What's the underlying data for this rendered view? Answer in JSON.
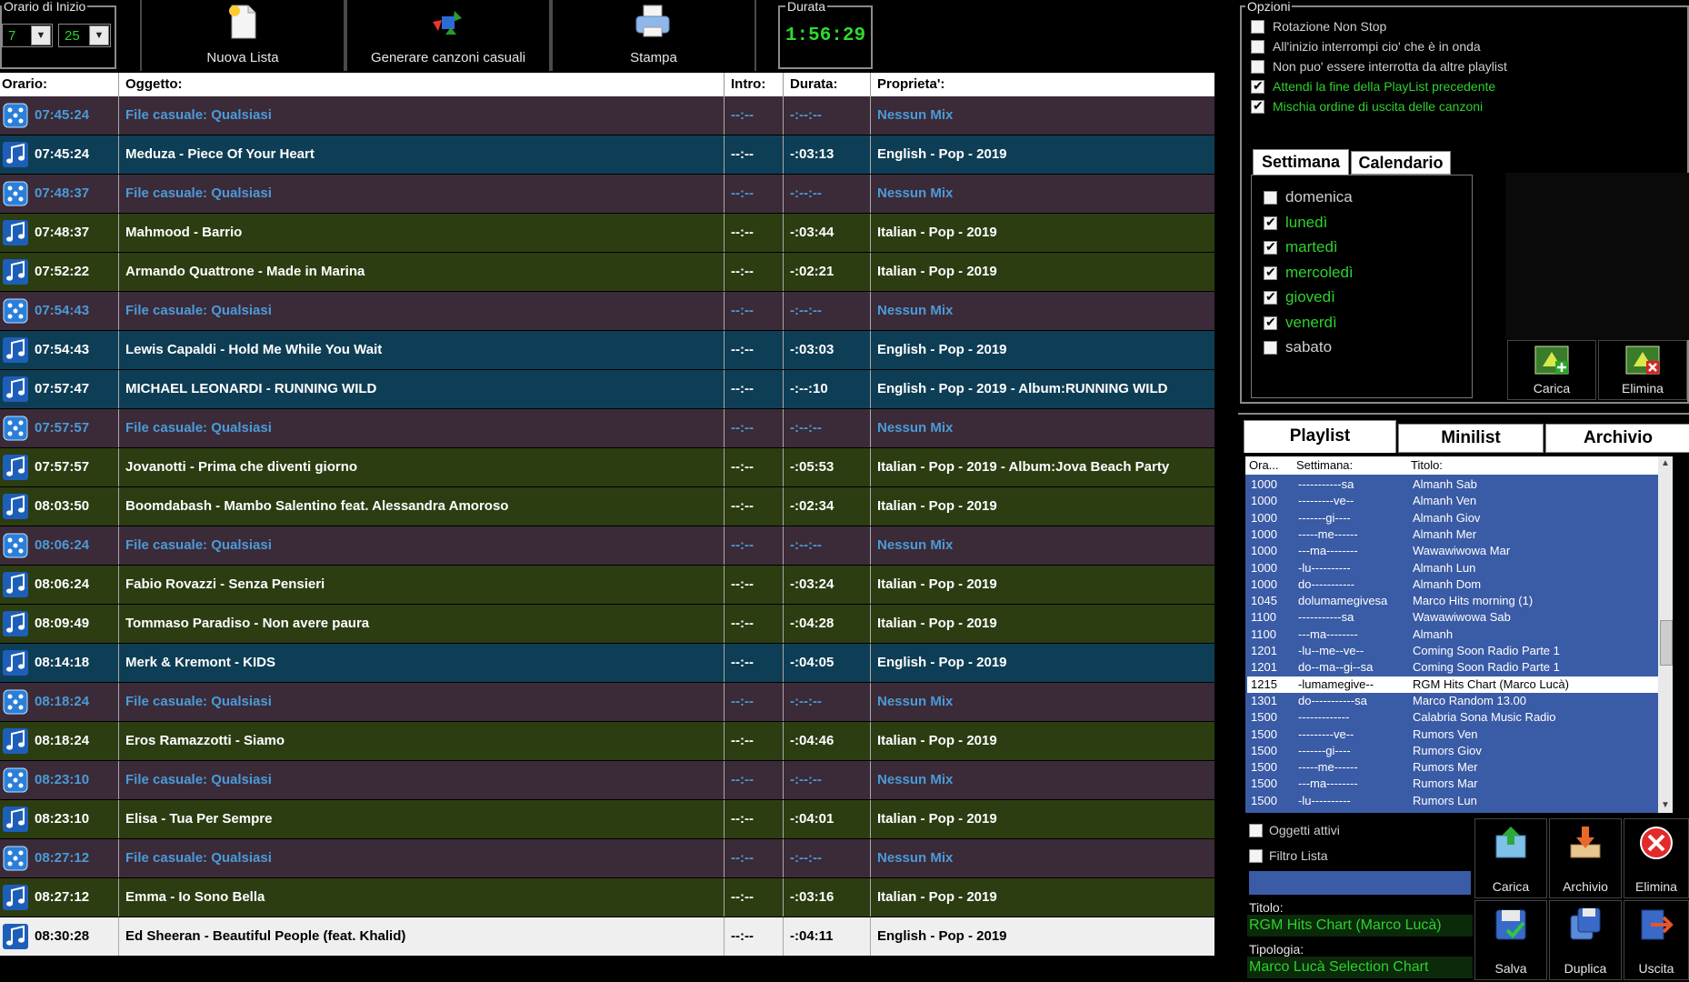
{
  "toolbar": {
    "start_time_legend": "Orario di Inizio",
    "start_hour": "7",
    "start_minute": "25",
    "new_list": "Nuova Lista",
    "random_songs": "Generare canzoni casuali",
    "print": "Stampa",
    "duration_legend": "Durata",
    "duration": "1:56:29"
  },
  "table": {
    "headers": {
      "time": "Orario:",
      "object": "Oggetto:",
      "intro": "Intro:",
      "duration": "Durata:",
      "property": "Proprieta':"
    },
    "rows": [
      {
        "type": "random",
        "time": "07:45:24",
        "object": "File casuale: Qualsiasi",
        "intro": "--:--",
        "duration": "-:--:--",
        "property": "Nessun Mix"
      },
      {
        "type": "en",
        "time": "07:45:24",
        "object": "Meduza - Piece Of Your Heart",
        "intro": "--:--",
        "duration": "-:03:13",
        "property": "English - Pop - 2019"
      },
      {
        "type": "random",
        "time": "07:48:37",
        "object": "File casuale: Qualsiasi",
        "intro": "--:--",
        "duration": "-:--:--",
        "property": "Nessun Mix"
      },
      {
        "type": "it",
        "time": "07:48:37",
        "object": "Mahmood - Barrio",
        "intro": "--:--",
        "duration": "-:03:44",
        "property": "Italian - Pop - 2019"
      },
      {
        "type": "it",
        "time": "07:52:22",
        "object": "Armando Quattrone - Made in Marina",
        "intro": "--:--",
        "duration": "-:02:21",
        "property": "Italian - Pop - 2019"
      },
      {
        "type": "random",
        "time": "07:54:43",
        "object": "File casuale: Qualsiasi",
        "intro": "--:--",
        "duration": "-:--:--",
        "property": "Nessun Mix"
      },
      {
        "type": "en",
        "time": "07:54:43",
        "object": "Lewis Capaldi - Hold Me While You Wait",
        "intro": "--:--",
        "duration": "-:03:03",
        "property": "English - Pop - 2019"
      },
      {
        "type": "en",
        "time": "07:57:47",
        "object": "MICHAEL LEONARDI - RUNNING WILD",
        "intro": "--:--",
        "duration": "-:--:10",
        "property": "English - Pop - 2019 - Album:RUNNING WILD"
      },
      {
        "type": "random",
        "time": "07:57:57",
        "object": "File casuale: Qualsiasi",
        "intro": "--:--",
        "duration": "-:--:--",
        "property": "Nessun Mix"
      },
      {
        "type": "it",
        "time": "07:57:57",
        "object": "Jovanotti - Prima che diventi giorno",
        "intro": "--:--",
        "duration": "-:05:53",
        "property": "Italian - Pop - 2019 - Album:Jova Beach Party"
      },
      {
        "type": "it",
        "time": "08:03:50",
        "object": "Boomdabash - Mambo Salentino feat. Alessandra Amoroso",
        "intro": "--:--",
        "duration": "-:02:34",
        "property": "Italian - Pop - 2019"
      },
      {
        "type": "random",
        "time": "08:06:24",
        "object": "File casuale: Qualsiasi",
        "intro": "--:--",
        "duration": "-:--:--",
        "property": "Nessun Mix"
      },
      {
        "type": "it",
        "time": "08:06:24",
        "object": "Fabio Rovazzi - Senza Pensieri",
        "intro": "--:--",
        "duration": "-:03:24",
        "property": "Italian - Pop - 2019"
      },
      {
        "type": "it",
        "time": "08:09:49",
        "object": "Tommaso Paradiso - Non avere paura",
        "intro": "--:--",
        "duration": "-:04:28",
        "property": "Italian - Pop - 2019"
      },
      {
        "type": "en",
        "time": "08:14:18",
        "object": "Merk & Kremont - KIDS",
        "intro": "--:--",
        "duration": "-:04:05",
        "property": "English - Pop - 2019"
      },
      {
        "type": "random",
        "time": "08:18:24",
        "object": "File casuale: Qualsiasi",
        "intro": "--:--",
        "duration": "-:--:--",
        "property": "Nessun Mix"
      },
      {
        "type": "it",
        "time": "08:18:24",
        "object": "Eros Ramazzotti - Siamo",
        "intro": "--:--",
        "duration": "-:04:46",
        "property": "Italian - Pop - 2019"
      },
      {
        "type": "random",
        "time": "08:23:10",
        "object": "File casuale: Qualsiasi",
        "intro": "--:--",
        "duration": "-:--:--",
        "property": "Nessun Mix"
      },
      {
        "type": "it",
        "time": "08:23:10",
        "object": "Elisa - Tua Per Sempre",
        "intro": "--:--",
        "duration": "-:04:01",
        "property": "Italian - Pop - 2019"
      },
      {
        "type": "random",
        "time": "08:27:12",
        "object": "File casuale: Qualsiasi",
        "intro": "--:--",
        "duration": "-:--:--",
        "property": "Nessun Mix"
      },
      {
        "type": "it",
        "time": "08:27:12",
        "object": "Emma - Io Sono Bella",
        "intro": "--:--",
        "duration": "-:03:16",
        "property": "Italian - Pop - 2019"
      },
      {
        "type": "last",
        "time": "08:30:28",
        "object": "Ed Sheeran - Beautiful People (feat. Khalid)",
        "intro": "--:--",
        "duration": "-:04:11",
        "property": "English - Pop - 2019"
      }
    ]
  },
  "options": {
    "legend": "Opzioni",
    "items": [
      {
        "label": "Rotazione Non Stop",
        "checked": false
      },
      {
        "label": "All'inizio interrompi cio' che è in onda",
        "checked": false
      },
      {
        "label": "Non puo' essere interrotta da altre playlist",
        "checked": false
      },
      {
        "label": "Attendi la fine della PlayList precedente",
        "checked": true
      },
      {
        "label": "Mischia ordine di uscita delle canzoni",
        "checked": true
      }
    ]
  },
  "week_tabs": {
    "week": "Settimana",
    "calendar": "Calendario"
  },
  "days": [
    {
      "label": "domenica",
      "checked": false
    },
    {
      "label": "lunedì",
      "checked": true
    },
    {
      "label": "martedì",
      "checked": true
    },
    {
      "label": "mercoledì",
      "checked": true
    },
    {
      "label": "giovedì",
      "checked": true
    },
    {
      "label": "venerdì",
      "checked": true
    },
    {
      "label": "sabato",
      "checked": false
    }
  ],
  "sched_buttons": {
    "load": "Carica",
    "delete": "Elimina"
  },
  "list_tabs": {
    "playlist": "Playlist",
    "minilist": "Minilist",
    "archive": "Archivio"
  },
  "playlist": {
    "headers": {
      "hour": "Ora...",
      "week": "Settimana:",
      "title": "Titolo:"
    },
    "rows": [
      {
        "h": "1000",
        "w": "-----------sa",
        "t": "Almanh Sab"
      },
      {
        "h": "1000",
        "w": "---------ve--",
        "t": "Almanh Ven"
      },
      {
        "h": "1000",
        "w": "-------gi----",
        "t": "Almanh Giov"
      },
      {
        "h": "1000",
        "w": "-----me------",
        "t": "Almanh Mer"
      },
      {
        "h": "1000",
        "w": "---ma--------",
        "t": "Wawawiwowa Mar"
      },
      {
        "h": "1000",
        "w": "-lu----------",
        "t": "Almanh Lun"
      },
      {
        "h": "1000",
        "w": "do-----------",
        "t": "Almanh Dom"
      },
      {
        "h": "1045",
        "w": "dolumamegivesa",
        "t": "Marco Hits morning (1)"
      },
      {
        "h": "1100",
        "w": "-----------sa",
        "t": "Wawawiwowa Sab"
      },
      {
        "h": "1100",
        "w": "---ma--------",
        "t": "Almanh"
      },
      {
        "h": "1201",
        "w": "-lu--me--ve--",
        "t": "Coming Soon Radio Parte 1"
      },
      {
        "h": "1201",
        "w": "do--ma--gi--sa",
        "t": "Coming Soon Radio Parte 1"
      },
      {
        "h": "1215",
        "w": "-lumamegive--",
        "t": "RGM Hits Chart (Marco Lucà)",
        "selected": true
      },
      {
        "h": "1301",
        "w": "do-----------sa",
        "t": "Marco Random 13.00"
      },
      {
        "h": "1500",
        "w": "-------------",
        "t": "Calabria Sona Music Radio"
      },
      {
        "h": "1500",
        "w": "---------ve--",
        "t": "Rumors Ven"
      },
      {
        "h": "1500",
        "w": "-------gi----",
        "t": "Rumors Giov"
      },
      {
        "h": "1500",
        "w": "-----me------",
        "t": "Rumors Mer"
      },
      {
        "h": "1500",
        "w": "---ma--------",
        "t": "Rumors Mar"
      },
      {
        "h": "1500",
        "w": "-lu----------",
        "t": "Rumors Lun"
      }
    ]
  },
  "filters": {
    "active_objects": "Oggetti attivi",
    "filter_list": "Filtro Lista"
  },
  "details": {
    "title_label": "Titolo:",
    "title_value": "RGM Hits Chart (Marco Lucà)",
    "type_label": "Tipologia:",
    "type_value": "Marco Lucà Selection Chart"
  },
  "bottom_buttons": {
    "load": "Carica",
    "archive": "Archivio",
    "delete": "Elimina",
    "save": "Salva",
    "duplicate": "Duplica",
    "exit": "Uscita"
  }
}
